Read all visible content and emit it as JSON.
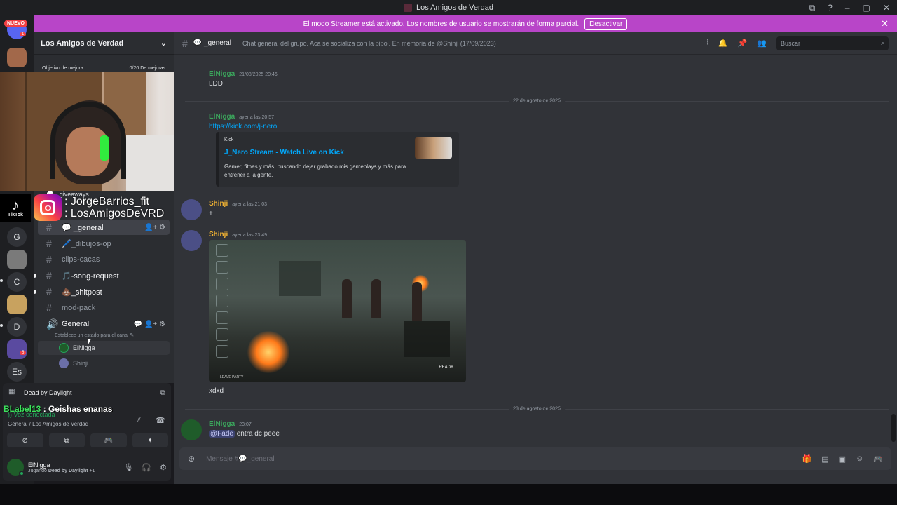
{
  "window": {
    "title": "Los Amigos de Verdad",
    "controls": [
      "⧉",
      "?",
      "–",
      "▢",
      "✕"
    ]
  },
  "servers": {
    "new_badge": "NUEVO",
    "letters": [
      "G",
      "C",
      "D",
      "Es"
    ],
    "badge_counts": [
      "1",
      "5"
    ]
  },
  "banner": {
    "text": "El modo Streamer está activado. Los nombres de usuario se mostrarán de forma parcial.",
    "button": "Desactivar"
  },
  "guild": {
    "name": "Los Amigos de Verdad",
    "boost_label": "Objetivo de mejora",
    "boost_value": "0/20 De mejoras"
  },
  "overlay": {
    "tiktok_label": "TikTok",
    "line1": ": JorgeBarrios_fit",
    "line2": ": LosAmigosDeVRD",
    "chat_user": "BLabel13",
    "chat_text": " : Geishas enanas"
  },
  "channels": [
    {
      "label": "💬 _giveaways"
    },
    {
      "label": "💬 _general"
    },
    {
      "label": "🖊️_dibujos-op"
    },
    {
      "label": "clips-cacas"
    },
    {
      "label": "🎵-song-request"
    },
    {
      "label": "💩_shitpost"
    },
    {
      "label": "mod-pack"
    }
  ],
  "voice": {
    "name": "General",
    "status": "Establece un estado para el canal",
    "users": [
      "ElNigga",
      "Shinji"
    ]
  },
  "activity": {
    "game": "Dead by Daylight",
    "connected": "Voz conectada",
    "location": "General / Los Amigos de Verdad"
  },
  "user": {
    "name": "ElNigga",
    "status_prefix": "Jugando ",
    "status_game": "Dead by Daylight",
    "status_suffix": " +1"
  },
  "chat": {
    "channel": "💬 _general",
    "topic": "Chat general del grupo. Aca se socializa con la pipol. En memoria de @Shinji (17/09/2023)",
    "search_placeholder": "Buscar",
    "messages": [
      {
        "author": "ElNigga",
        "time": "21/08/2025 20:46",
        "text": "LDD"
      },
      {
        "author": "ElNigga",
        "time": "ayer a las 20:57",
        "text": "https://kick.com/j-nero"
      },
      {
        "author": "Shinji",
        "time": "ayer a las 21:03",
        "text": "+"
      },
      {
        "author": "Shinji",
        "time": "ayer a las 23:49",
        "text": "xdxd"
      },
      {
        "author": "ElNigga",
        "time": "23:07",
        "mention": "@Fade",
        "text": " entra dc peee"
      }
    ],
    "dividers": [
      "22 de agosto de 2025",
      "23 de agosto de 2025"
    ],
    "embed": {
      "provider": "Kick",
      "title": "J_Nero Stream - Watch Live on Kick",
      "description": "Gamer, fitnes y más, buscando dejar grabado mis gameplays y más para entrener a la gente."
    },
    "game_image": {
      "ready_label": "READY",
      "leave_label": "LEAVE PARTY"
    },
    "input_placeholder": "Mensaje #💬_general"
  },
  "colors": {
    "green_user": "#3ba55c",
    "yellow_user": "#f0b232",
    "banner": "#b845c8",
    "link": "#00a8fc"
  }
}
